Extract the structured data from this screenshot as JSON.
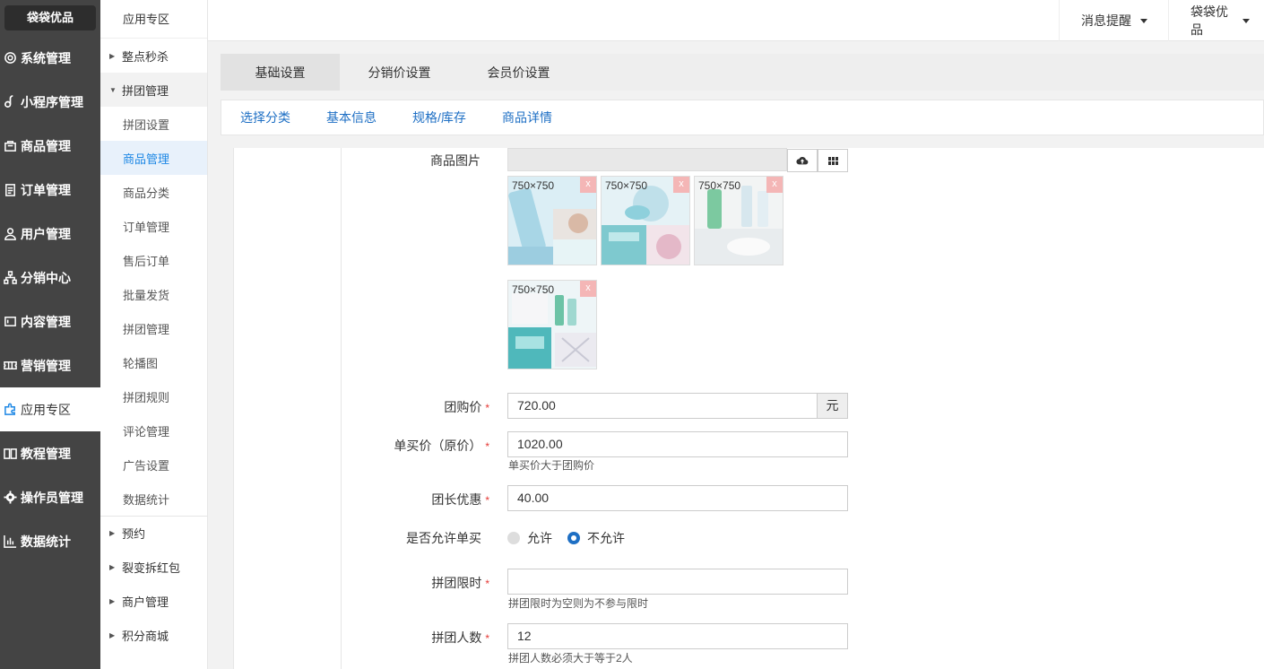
{
  "brand": "袋袋优品",
  "sidebar": {
    "items": [
      {
        "label": "系统管理",
        "icon": "gear-icon"
      },
      {
        "label": "小程序管理",
        "icon": "link-icon"
      },
      {
        "label": "商品管理",
        "icon": "bag-icon"
      },
      {
        "label": "订单管理",
        "icon": "clipboard-icon"
      },
      {
        "label": "用户管理",
        "icon": "user-icon"
      },
      {
        "label": "分销中心",
        "icon": "sitemap-icon"
      },
      {
        "label": "内容管理",
        "icon": "content-icon"
      },
      {
        "label": "营销管理",
        "icon": "ticket-icon"
      },
      {
        "label": "应用专区",
        "icon": "puzzle-icon"
      },
      {
        "label": "教程管理",
        "icon": "book-icon"
      },
      {
        "label": "操作员管理",
        "icon": "cog-icon"
      },
      {
        "label": "数据统计",
        "icon": "bar-chart-icon"
      }
    ]
  },
  "submenu": {
    "title": "应用专区",
    "groups": [
      "整点秒杀",
      "拼团管理",
      "预约",
      "裂变拆红包",
      "商户管理",
      "积分商城"
    ],
    "items": [
      "拼团设置",
      "商品管理",
      "商品分类",
      "订单管理",
      "售后订单",
      "批量发货",
      "拼团管理",
      "轮播图",
      "拼团规则",
      "评论管理",
      "广告设置",
      "数据统计"
    ]
  },
  "topbar": {
    "notifications": "消息提醒",
    "account": "袋袋优品"
  },
  "tabs": [
    "基础设置",
    "分销价设置",
    "会员价设置"
  ],
  "subtabs": [
    "选择分类",
    "基本信息",
    "规格/库存",
    "商品详情"
  ],
  "form": {
    "images_label": "商品图片",
    "thumb_size": "750×750",
    "thumb_delete": "x",
    "group_price": {
      "label": "团购价",
      "value": "720.00",
      "unit": "元"
    },
    "single_price": {
      "label": "单买价（原价）",
      "value": "1020.00",
      "help": "单买价大于团购价"
    },
    "leader_discount": {
      "label": "团长优惠",
      "value": "40.00"
    },
    "allow_single": {
      "label": "是否允许单买",
      "options": [
        "允许",
        "不允许"
      ],
      "selected": "不允许"
    },
    "time_limit": {
      "label": "拼团限时",
      "value": "",
      "help": "拼团限时为空则为不参与限时"
    },
    "group_size": {
      "label": "拼团人数",
      "value": "12",
      "help": "拼团人数必须大于等于2人"
    },
    "required_mark": "*"
  },
  "colors": {
    "sidebar_bg": "#444444",
    "accent": "#1e6fc4",
    "required": "#e53935"
  }
}
